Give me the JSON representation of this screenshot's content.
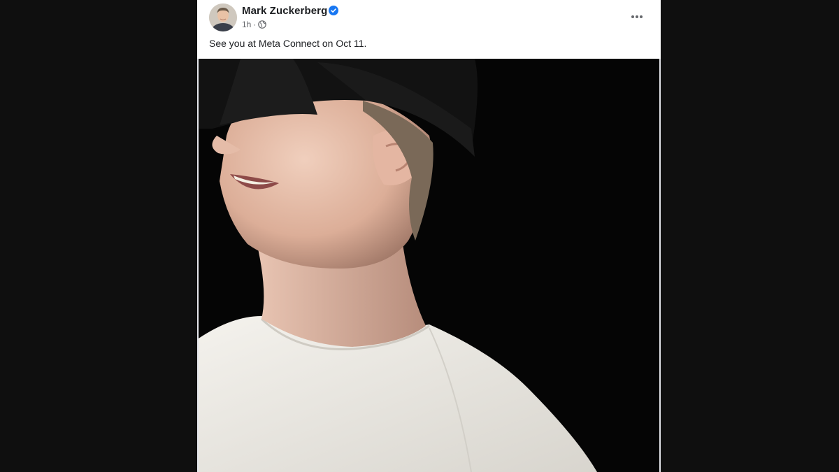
{
  "post": {
    "author": {
      "name": "Mark Zuckerberg",
      "verified_icon": "verified-badge-icon",
      "avatar_icon": "profile-avatar"
    },
    "meta": {
      "time": "1h",
      "separator": "·",
      "audience_icon": "globe-icon"
    },
    "menu_icon": "more-options-icon",
    "text": "See you at Meta Connect on Oct 11.",
    "photo": {
      "subject": "photo of person wearing headset"
    }
  },
  "colors": {
    "background": "#0f0f0f",
    "card": "#ffffff",
    "name_text": "#1c1e21",
    "meta_text": "#65676b",
    "verified_blue": "#1877f2"
  }
}
